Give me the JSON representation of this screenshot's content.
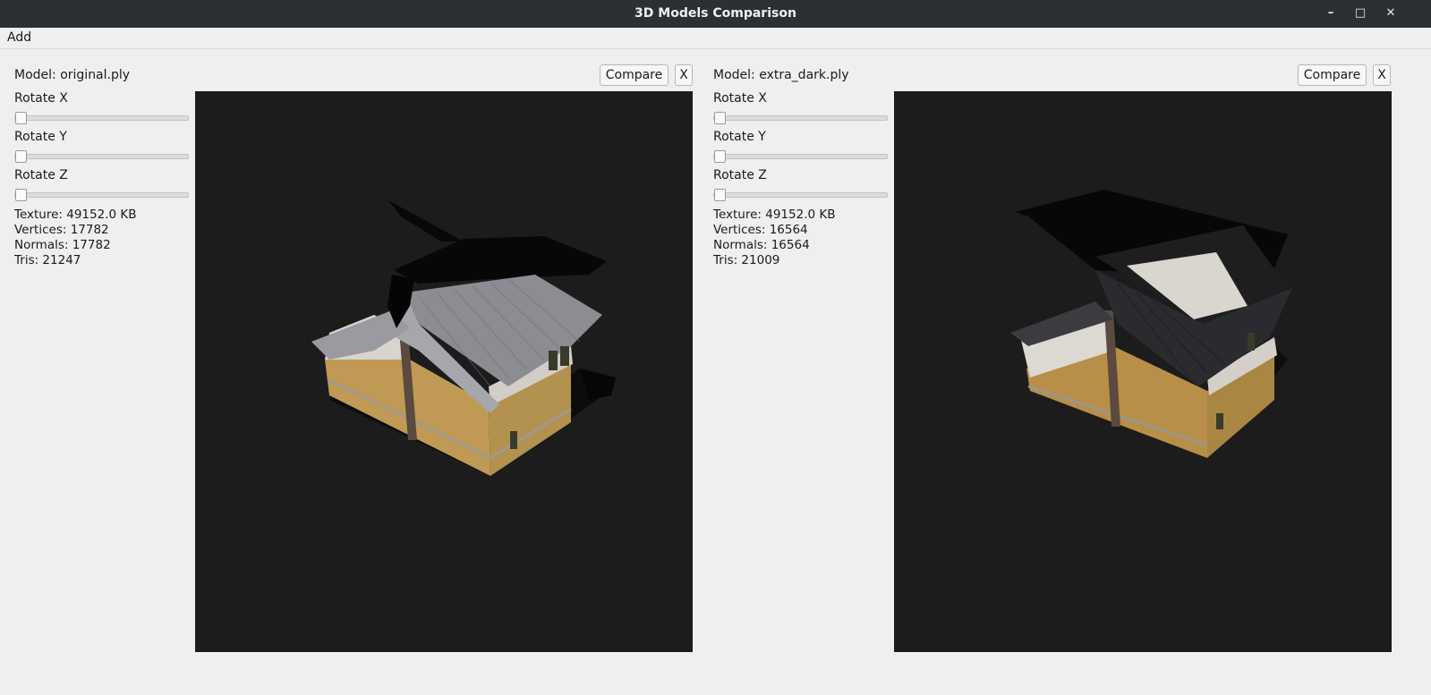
{
  "window": {
    "title": "3D Models Comparison",
    "minimize_glyph": "–",
    "maximize_glyph": "□",
    "close_glyph": "✕"
  },
  "menu": {
    "items": [
      {
        "label": "Add"
      }
    ]
  },
  "panels": [
    {
      "model_label": "Model: original.ply",
      "compare_label": "Compare",
      "close_label": "X",
      "rotate_x_label": "Rotate X",
      "rotate_y_label": "Rotate Y",
      "rotate_z_label": "Rotate Z",
      "rotate_x_value": 0,
      "rotate_y_value": 0,
      "rotate_z_value": 0,
      "stats": {
        "texture": "Texture: 49152.0 KB",
        "vertices": "Vertices: 17782",
        "normals": "Normals: 17782",
        "tris": "Tris: 21247"
      }
    },
    {
      "model_label": "Model: extra_dark.ply",
      "compare_label": "Compare",
      "close_label": "X",
      "rotate_x_label": "Rotate X",
      "rotate_y_label": "Rotate Y",
      "rotate_z_label": "Rotate Z",
      "rotate_x_value": 0,
      "rotate_y_value": 0,
      "rotate_z_value": 0,
      "stats": {
        "texture": "Texture: 49152.0 KB",
        "vertices": "Vertices: 16564",
        "normals": "Normals: 16564",
        "tris": "Tris: 21009"
      }
    }
  ],
  "colors": {
    "titlebar_bg": "#2c2f33",
    "window_bg": "#efefef",
    "viewport_bg": "#1c1c1c"
  }
}
